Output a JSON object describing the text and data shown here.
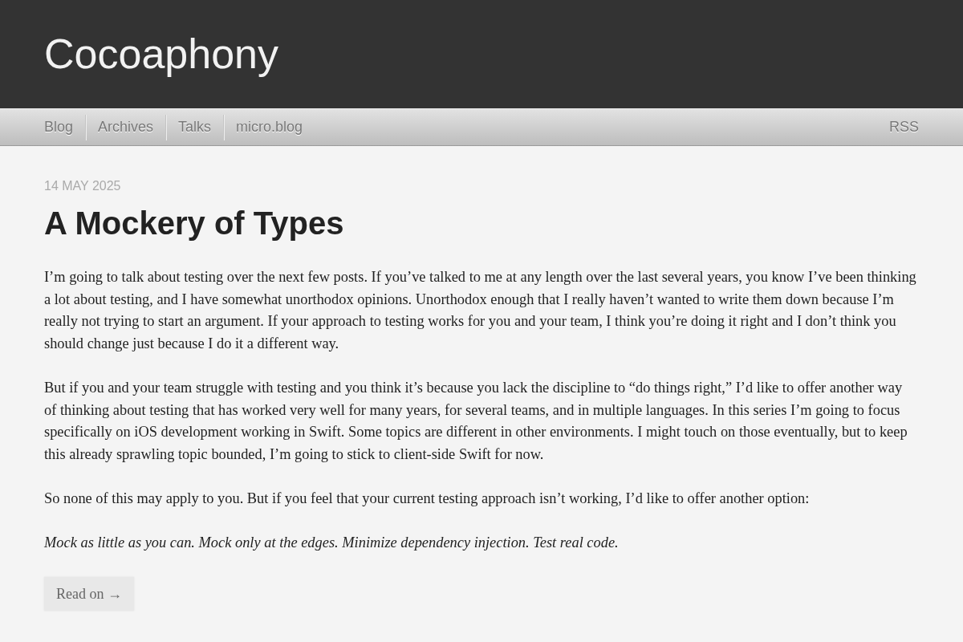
{
  "site": {
    "title": "Cocoaphony"
  },
  "nav": {
    "items": [
      {
        "label": "Blog"
      },
      {
        "label": "Archives"
      },
      {
        "label": "Talks"
      },
      {
        "label": "micro.blog"
      }
    ],
    "feed": {
      "label": "RSS"
    }
  },
  "post": {
    "date": "14 MAY 2025",
    "title": "A Mockery of Types",
    "paragraphs": [
      {
        "kind": "plain",
        "text": "I’m going to talk about testing over the next few posts. If you’ve talked to me at any length over the last several years, you know I’ve been thinking a lot about testing, and I have somewhat unorthodox opinions. Unorthodox enough that I really haven’t wanted to write them down because I’m really not trying to start an argument. If your approach to testing works for you and your team, I think you’re doing it right and I don’t think you should change just because I do it a different way."
      },
      {
        "kind": "plain",
        "text": "But if you and your team struggle with testing and you think it’s because you lack the discipline to “do things right,” I’d like to offer another way of thinking about testing that has worked very well for many years, for several teams, and in multiple languages. In this series I’m going to focus specifically on iOS development working in Swift. Some topics are different in other environments. I might touch on those eventually, but to keep this already sprawling topic bounded, I’m going to stick to client-side Swift for now."
      },
      {
        "kind": "plain",
        "text": "So none of this may apply to you. But if you feel that your current testing approach isn’t working, I’d like to offer another option:"
      },
      {
        "kind": "emphasis",
        "text": "Mock as little as you can. Mock only at the edges. Minimize dependency injection. Test real code."
      }
    ],
    "read_more": {
      "label": "Read on →"
    }
  }
}
